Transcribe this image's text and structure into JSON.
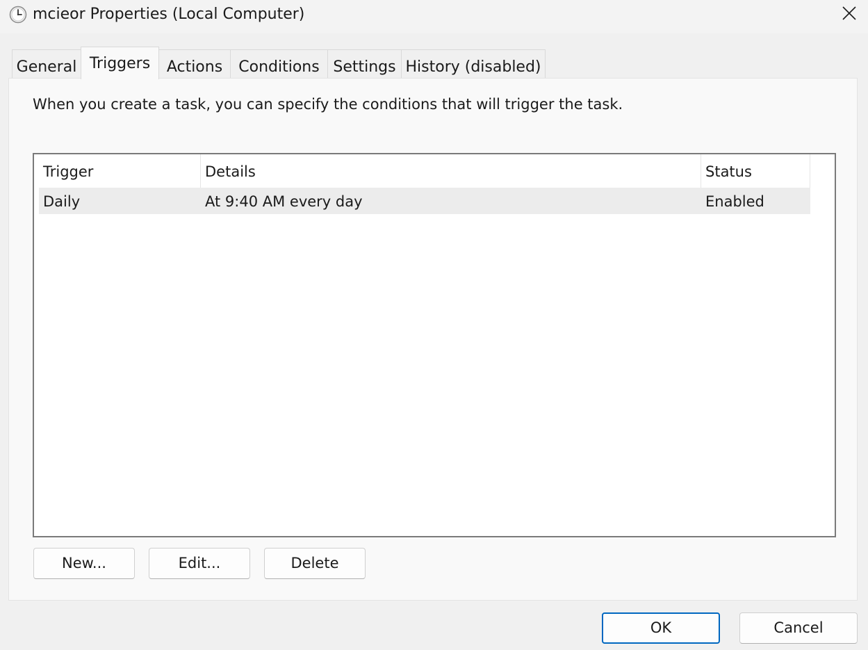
{
  "window": {
    "title": "mcieor Properties (Local Computer)",
    "icon": "clock-icon"
  },
  "tabs": [
    {
      "label": "General",
      "active": false
    },
    {
      "label": "Triggers",
      "active": true
    },
    {
      "label": "Actions",
      "active": false
    },
    {
      "label": "Conditions",
      "active": false
    },
    {
      "label": "Settings",
      "active": false
    },
    {
      "label": "History (disabled)",
      "active": false
    }
  ],
  "triggers_panel": {
    "intro": "When you create a task, you can specify the conditions that will trigger the task.",
    "columns": [
      "Trigger",
      "Details",
      "Status"
    ],
    "rows": [
      {
        "trigger": "Daily",
        "details": "At 9:40 AM every day",
        "status": "Enabled"
      }
    ],
    "buttons": {
      "new": "New...",
      "edit": "Edit...",
      "delete": "Delete"
    }
  },
  "footer": {
    "ok": "OK",
    "cancel": "Cancel"
  },
  "colors": {
    "accent": "#0067c0",
    "selected_row": "#ececec",
    "panel_bg": "#f9f9f9"
  }
}
